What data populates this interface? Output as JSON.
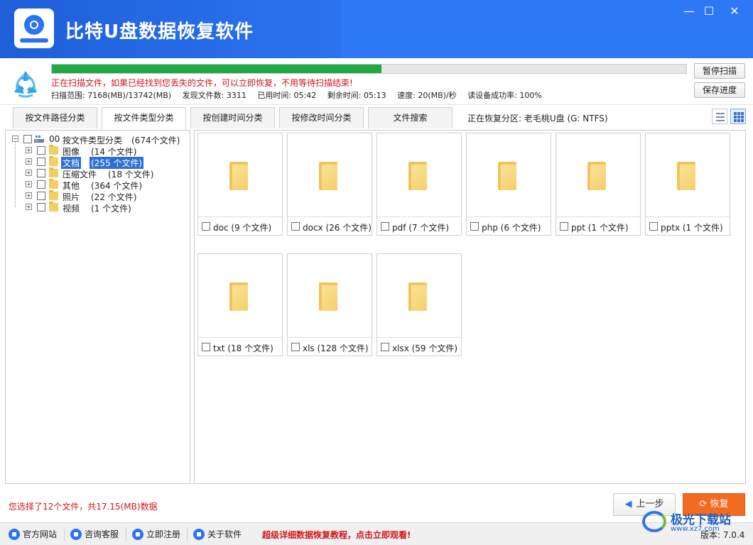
{
  "app": {
    "title": "比特U盘数据恢复软件"
  },
  "window_controls": {
    "minimize": "—",
    "maximize": "☐",
    "close": "✕"
  },
  "scan": {
    "progress": 0.52,
    "message": "正在扫描文件，如果已经找到您丢失的文件，可以立即恢复，不用等待扫描结束!",
    "stats": {
      "range": "扫描范围: 7168(MB)/13742(MB)",
      "found": "发现文件数: 3311",
      "elapsed": "已用时间: 05:42",
      "remaining": "剩余时间: 05:13",
      "speed": "速度: 20(MB)/秒",
      "success_rate": "读设备成功率: 100%"
    },
    "pause_button": "暂停扫描",
    "save_button": "保存进度"
  },
  "tabs": [
    {
      "label": "按文件路径分类",
      "active": false
    },
    {
      "label": "按文件类型分类",
      "active": true
    },
    {
      "label": "按创建时间分类",
      "active": false
    },
    {
      "label": "按修改时间分类",
      "active": false
    },
    {
      "label": "文件搜索",
      "active": false
    }
  ],
  "partition_label": "正在恢复分区: 老毛桃U盘 (G: NTFS)",
  "tree": {
    "root": {
      "id": "00",
      "label": "按文件类型分类",
      "count": "(674个文件)"
    },
    "items": [
      {
        "label": "图像",
        "count": "(14 个文件)",
        "selected": false
      },
      {
        "label": "文档",
        "count": "(255 个文件)",
        "selected": true
      },
      {
        "label": "压缩文件",
        "count": "(18 个文件)",
        "selected": false
      },
      {
        "label": "其他",
        "count": "(364 个文件)",
        "selected": false
      },
      {
        "label": "照片",
        "count": "(22 个文件)",
        "selected": false
      },
      {
        "label": "视频",
        "count": "(1 个文件)",
        "selected": false
      }
    ]
  },
  "grid": {
    "items": [
      {
        "label": "doc  (9 个文件)"
      },
      {
        "label": "docx  (26 个文件)"
      },
      {
        "label": "pdf  (7 个文件)"
      },
      {
        "label": "php  (6 个文件)"
      },
      {
        "label": "ppt  (1 个文件)"
      },
      {
        "label": "pptx  (1 个文件)"
      },
      {
        "label": "txt  (18 个文件)"
      },
      {
        "label": "xls  (128 个文件)"
      },
      {
        "label": "xlsx  (59 个文件)"
      }
    ]
  },
  "selection_info": "您选择了12个文件，共17.15(MB)数据",
  "buttons": {
    "prev": "上一步",
    "recover": "恢复"
  },
  "statusbar": {
    "links": [
      "官方网站",
      "咨询客服",
      "立即注册",
      "关于软件"
    ],
    "tutorial": "超级详细数据恢复教程，点击立即观看!",
    "version": "版本: 7.0.4"
  },
  "watermark": {
    "text": "极光下载站",
    "url": "www.xz7.com"
  },
  "colors": {
    "titlebar": "#2b74ef",
    "progress": "#1fa843",
    "alert_text": "#d2151b",
    "recover_button": "#f26b22",
    "selection": "#2f6fd6"
  }
}
